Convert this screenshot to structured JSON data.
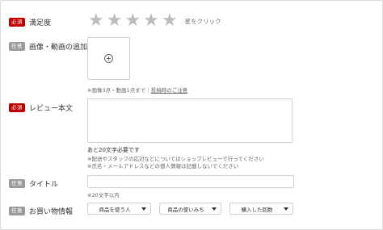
{
  "labels": {
    "satisfaction": "満足度",
    "image_video": "画像・動画の追加",
    "review_body": "レビュー本文",
    "title": "タイトル",
    "purchase_info": "お買い物情報"
  },
  "badges": {
    "required": "必須",
    "optional": "任意"
  },
  "rating": {
    "stars": 5,
    "value": 0,
    "hint": "星をクリック"
  },
  "image_upload": {
    "note_prefix": "※画像3点・動画1点まで｜",
    "note_link": "投稿時のご注意"
  },
  "review": {
    "char_requirement": "あと20文字必要です",
    "note1": "※配送やスタッフの応対などについてはショップレビューで行ってください",
    "note2": "※氏名・メールアドレスなどの個人情報は記載しないでください"
  },
  "title_field": {
    "note": "※20文字以内"
  },
  "purchase": {
    "selects": [
      {
        "label": "商品を使う人"
      },
      {
        "label": "商品の使いみち"
      },
      {
        "label": "購入した回数"
      }
    ]
  },
  "colors": {
    "required_badge": "#bf0000",
    "optional_badge": "#9a9a9a",
    "star_inactive": "#bdbdbd"
  },
  "icons": {
    "star": "star-icon",
    "add": "add-circle-icon",
    "caret": "chevron-down-icon"
  }
}
